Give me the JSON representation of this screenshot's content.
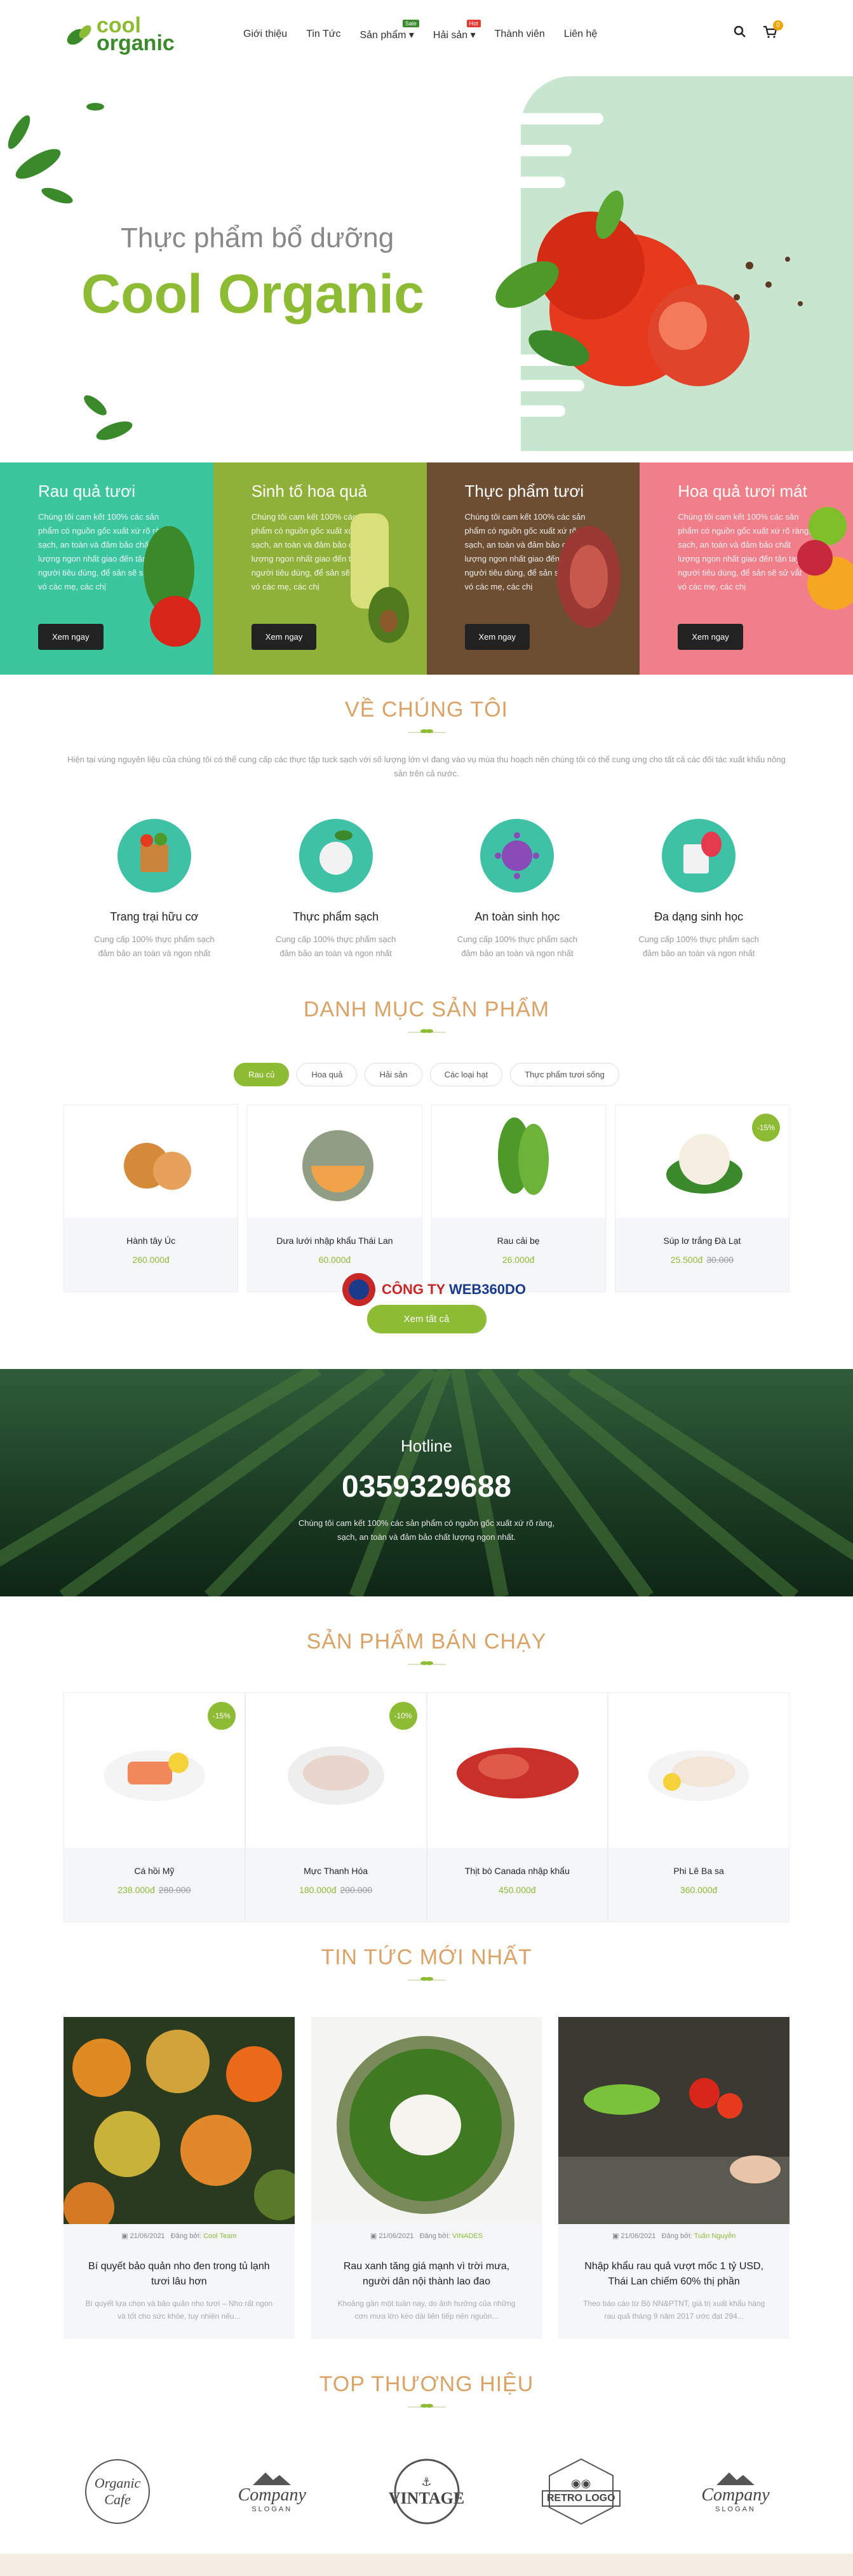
{
  "header": {
    "logo": {
      "line1": "cool",
      "line2": "organic"
    },
    "nav": [
      {
        "label": "Giới thiệu"
      },
      {
        "label": "Tin Tức"
      },
      {
        "label": "Sản phẩm",
        "badge": "Sale"
      },
      {
        "label": "Hải sản",
        "badge": "Hot"
      },
      {
        "label": "Thành viên"
      },
      {
        "label": "Liên hệ"
      }
    ],
    "cart_count": "0",
    "colors": {
      "sale_badge": "#3a8a2c",
      "hot_badge": "#e53935"
    }
  },
  "hero": {
    "subtitle": "Thực phẩm bổ dưỡng",
    "title": "Cool Organic"
  },
  "categories": [
    {
      "title": "Rau quả tươi",
      "text": "Chúng tôi cam kết 100% các sản phẩm có nguồn gốc xuất xứ rõ ràng, sạch, an toàn và đảm bảo chất lượng ngon nhất giao đến tận tay người tiêu dùng, để sản sẽ sử vắt vó các mẹ, các chị",
      "button": "Xem ngay",
      "color": "#3cc69e"
    },
    {
      "title": "Sinh tố hoa quả",
      "text": "Chúng tôi cam kết 100% các sản phẩm có nguồn gốc xuất xứ rõ ràng, sạch, an toàn và đảm bảo chất lượng ngon nhất giao đến tận tay người tiêu dùng, để sản sẽ sử vắt vó các mẹ, các chị",
      "button": "Xem ngay",
      "color": "#8fb13a"
    },
    {
      "title": "Thực phẩm tươi",
      "text": "Chúng tôi cam kết 100% các sản phẩm có nguồn gốc xuất xứ rõ ràng, sạch, an toàn và đảm bảo chất lượng ngon nhất giao đến tận tay người tiêu dùng, để sản sẽ sử vắt vó các mẹ, các chị",
      "button": "Xem ngay",
      "color": "#6e4e33"
    },
    {
      "title": "Hoa quả tươi mát",
      "text": "Chúng tôi cam kết 100% các sản phẩm có nguồn gốc xuất xứ rõ ràng, sạch, an toàn và đảm bảo chất lượng ngon nhất giao đến tận tay người tiêu dùng, để sản sẽ sử vắt vó các mẹ, các chị",
      "button": "Xem ngay",
      "color": "#f07f8a"
    }
  ],
  "about": {
    "title": "VỀ CHÚNG TÔI",
    "text": "Hiện tại vùng nguyên liệu của chúng tôi có thể cung cấp các thực tập tuck sạch với số lượng lớn vì đang vào vụ mùa thu hoạch nên chúng tôi có thể cung ứng cho tất cả các đối tác xuất khẩu nông sản trên cả nước.",
    "features": [
      {
        "title": "Trang trại hữu cơ",
        "text": "Cung cấp 100% thực phẩm sạch đảm bảo an toàn và ngon nhất",
        "icon": "basket-icon"
      },
      {
        "title": "Thực phẩm sạch",
        "text": "Cung cấp 100% thực phẩm sạch đảm bảo an toàn và ngon nhất",
        "icon": "turnip-icon"
      },
      {
        "title": "An toàn sinh học",
        "text": "Cung cấp 100% thực phẩm sạch đảm bảo an toàn và ngon nhất",
        "icon": "virus-icon"
      },
      {
        "title": "Đa dạng sinh học",
        "text": "Cung cấp 100% thực phẩm sạch đảm bảo an toàn và ngon nhất",
        "icon": "strawberry-icon"
      }
    ]
  },
  "catalog": {
    "title": "DANH MỤC SẢN PHẨM",
    "tabs": [
      "Rau củ",
      "Hoa quả",
      "Hải sản",
      "Các loại hạt",
      "Thực phẩm tươi sống"
    ],
    "products": [
      {
        "name": "Hành tây Úc",
        "price": "260.000đ",
        "old": "",
        "sale": ""
      },
      {
        "name": "Dưa lưới nhập khẩu Thái Lan",
        "price": "60.000đ",
        "old": "",
        "sale": ""
      },
      {
        "name": "Rau cải bẹ",
        "price": "26.000đ",
        "old": "",
        "sale": ""
      },
      {
        "name": "Súp lơ trắng Đà Lạt",
        "price": "25.500đ",
        "old": "30.000",
        "sale": "-15%"
      }
    ],
    "more": "Xem tất cả"
  },
  "watermark": {
    "a": "CÔNG TY ",
    "b": "WEB360DO"
  },
  "hotline": {
    "title": "Hotline",
    "number": "0359329688",
    "text1": "Chúng tôi cam kết 100% các sản phẩm có nguồn gốc xuất xứ rõ ràng,",
    "text2": "sạch, an toàn và đảm bảo chất lượng ngon nhất."
  },
  "bestsellers": {
    "title": "SẢN PHẨM BÁN CHẠY",
    "products": [
      {
        "name": "Cá hồi Mỹ",
        "price": "238.000đ",
        "old": "280.000",
        "sale": "-15%"
      },
      {
        "name": "Mực Thanh Hóa",
        "price": "180.000đ",
        "old": "200.000",
        "sale": "-10%"
      },
      {
        "name": "Thịt bò Canada nhập khẩu",
        "price": "450.000đ",
        "old": "",
        "sale": ""
      },
      {
        "name": "Phi Lê Ba sa",
        "price": "360.000đ",
        "old": "",
        "sale": ""
      }
    ]
  },
  "news": {
    "title": "TIN TỨC MỚI NHẤT",
    "items": [
      {
        "date": "21/06/2021",
        "by": "Đăng bởi:",
        "author": "Cool Team",
        "title": "Bí quyết bảo quản nho đen trong tủ lạnh tươi lâu hơn",
        "text": "Bí quyết lựa chọn và bảo quản nho tươi – Nho rất ngon và tốt cho sức khỏe, tuy nhiên nếu..."
      },
      {
        "date": "21/06/2021",
        "by": "Đăng bởi:",
        "author": "VINADES",
        "title": "Rau xanh tăng giá mạnh vì trời mưa, người dân nội thành lao đao",
        "text": "Khoảng gần một tuần nay, do ảnh hưởng của những cơn mưa lớn kéo dài liên tiếp nên nguồn..."
      },
      {
        "date": "21/06/2021",
        "by": "Đăng bởi:",
        "author": "Tuấn Nguyễn",
        "title": "Nhập khẩu rau quả vượt mốc 1 tỷ USD, Thái Lan chiếm 60% thị phần",
        "text": "Theo báo cáo từ Bộ NN&PTNT, giá trị xuất khẩu hàng rau quả tháng 9 năm 2017 ước đạt 294..."
      }
    ]
  },
  "brands": {
    "title": "TOP THƯƠNG HIỆU",
    "items": [
      {
        "a": "Organic",
        "b": "Cafe"
      },
      {
        "a": "Company",
        "b": "SLOGAN"
      },
      {
        "a": "VINTAGE",
        "b": ""
      },
      {
        "a": "RETRO LOGO",
        "b": ""
      },
      {
        "a": "Company",
        "b": "SLOGAN"
      }
    ]
  }
}
